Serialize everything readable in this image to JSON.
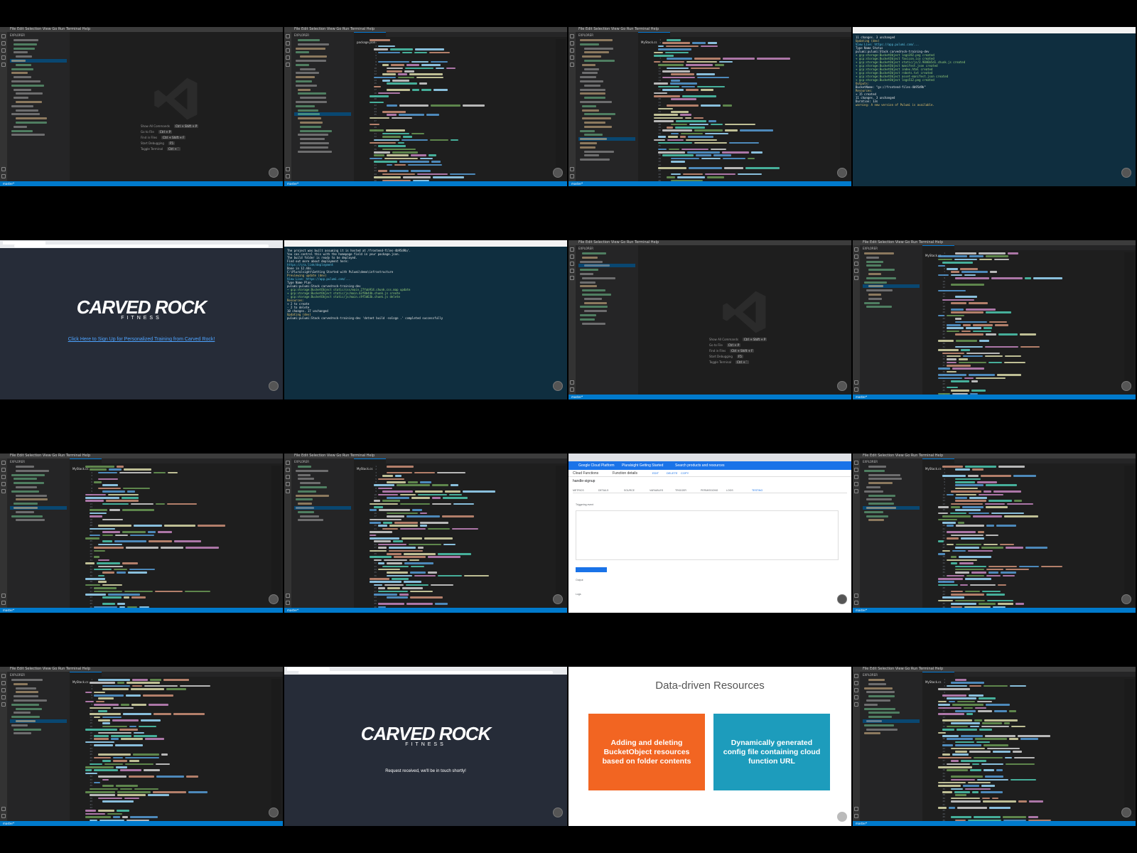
{
  "vscode": {
    "menu": "File  Edit  Selection  View  Go  Run  Terminal  Help",
    "explorer": "EXPLORER",
    "tab_package": "package.json",
    "tab_mystack": "MyStack.cs",
    "status_branch": "master*",
    "welcome_items": [
      {
        "label": "Show All Commands",
        "key": "Ctrl + Shift + P"
      },
      {
        "label": "Go to File",
        "key": "Ctrl + P"
      },
      {
        "label": "Find in Files",
        "key": "Ctrl + Shift + F"
      },
      {
        "label": "Start Debugging",
        "key": "F5"
      },
      {
        "label": "Toggle Terminal",
        "key": "Ctrl + `"
      }
    ]
  },
  "terminal": {
    "lines": [
      {
        "t": "The project was built assuming it is hosted at /frontend-files-4b95d9b/.",
        "c": ""
      },
      {
        "t": "You can control this with the homepage field in your package.json.",
        "c": ""
      },
      {
        "t": "The build folder is ready to be deployed.",
        "c": ""
      },
      {
        "t": "Find out more about deployment here:",
        "c": ""
      },
      {
        "t": "  https://cra.link/deployment",
        "c": "c"
      },
      {
        "t": "Done in 12.44s.",
        "c": ""
      },
      {
        "t": "C:\\Pluralsight\\Getting Started with Pulumi\\demo\\infrastructure",
        "c": ""
      },
      {
        "t": "Previewing update (dev)",
        "c": "y"
      },
      {
        "t": "View Live: https://app.pulumi.com/...",
        "c": "c"
      },
      {
        "t": "    Type                          Name                           Plan",
        "c": ""
      },
      {
        "t": "    pulumi:pulumi:Stack          carvedrock-training-dev",
        "c": ""
      },
      {
        "t": " ~  gcp:storage:BucketObject     static/css/main.27fab914.chunk.css.map   update",
        "c": "g"
      },
      {
        "t": " +  gcp:storage:BucketObject     static/js/main.63f8b44b.chunk.js         create",
        "c": "g"
      },
      {
        "t": " -  gcp:storage:BucketObject     static/js/main.c9f5d63b.chunk.js         delete",
        "c": "g"
      },
      {
        "t": "Resources:",
        "c": "y"
      },
      {
        "t": "    + 2 to create",
        "c": ""
      },
      {
        "t": "    - 2 to delete",
        "c": ""
      },
      {
        "t": "    10 changes. 17 unchanged",
        "c": ""
      },
      {
        "t": "Updating (dev)",
        "c": "y"
      },
      {
        "t": "    pulumi:pulumi:Stack   carvedrock-training-dev   'dotnet build -nologo .' completed successfully",
        "c": ""
      }
    ],
    "top_lines": [
      {
        "t": "  11 changes. 3 unchanged",
        "c": ""
      },
      {
        "t": "Updating (dev)",
        "c": "y"
      },
      {
        "t": "View Live: https://app.pulumi.com/...",
        "c": "c"
      },
      {
        "t": "    Type                        Name                       Status",
        "c": ""
      },
      {
        "t": "    pulumi:pulumi:Stack         carvedrock-training-dev",
        "c": ""
      },
      {
        "t": " +  gcp:storage:BucketObject   logo192.png                created",
        "c": "g"
      },
      {
        "t": " +  gcp:storage:BucketObject   favicon.ico                created",
        "c": "g"
      },
      {
        "t": " +  gcp:storage:BucketObject   static/js/2.9846b5d1.chunk.js  created",
        "c": "g"
      },
      {
        "t": " +  gcp:storage:BucketObject   manifest.json              created",
        "c": "g"
      },
      {
        "t": " +  gcp:storage:BucketObject   index.html                 created",
        "c": "g"
      },
      {
        "t": " +  gcp:storage:BucketObject   robots.txt                 created",
        "c": "g"
      },
      {
        "t": " +  gcp:storage:BucketObject   asset-manifest.json        created",
        "c": "g"
      },
      {
        "t": " +  gcp:storage:BucketObject   logo512.png                created",
        "c": "g"
      },
      {
        "t": "Outputs:",
        "c": "y"
      },
      {
        "t": "    BucketName: \"gs://frontend-files-4b95d9b\"",
        "c": ""
      },
      {
        "t": "Resources:",
        "c": "y"
      },
      {
        "t": "    + 15 created",
        "c": ""
      },
      {
        "t": "    11 changes. 3 unchanged",
        "c": ""
      },
      {
        "t": "Duration: 13s",
        "c": ""
      },
      {
        "t": "warning: A new version of Pulumi is available.",
        "c": "y"
      }
    ]
  },
  "carvedrock": {
    "logo": "CARVED ROCK",
    "tagline": "FITNESS",
    "signup_link": "Click Here to Sign Up for Personalized Training from Carved Rock!",
    "received": "Request received, we'll be in touch shortly!"
  },
  "gcp": {
    "product": "Google Cloud Platform",
    "project": "Pluralsight Getting Started",
    "search": "Search products and resources",
    "service": "Cloud Functions",
    "page": "Function details",
    "actions": [
      "EDIT",
      "DELETE",
      "COPY"
    ],
    "function_name": "handle-signup",
    "tabs": [
      "METRICS",
      "DETAILS",
      "SOURCE",
      "VARIABLES",
      "TRIGGER",
      "PERMISSIONS",
      "LOGS",
      "TESTING"
    ],
    "trigger_label": "Triggering event",
    "test_button": "TEST THE FUNCTION",
    "output_label": "Output",
    "logs_label": "Logs"
  },
  "slide": {
    "title": "Data-driven Resources",
    "card1": "Adding and deleting BucketObject resources based on folder contents",
    "card2": "Dynamically generated config file containing cloud function URL",
    "card1_color": "#f26522",
    "card2_color": "#1d9cbc"
  }
}
